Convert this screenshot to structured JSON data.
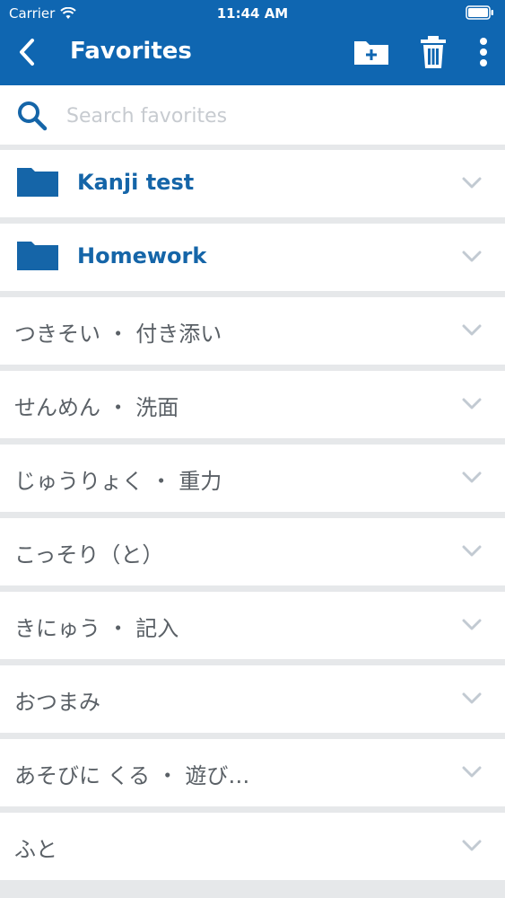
{
  "status_bar": {
    "carrier": "Carrier",
    "time": "11:44 AM"
  },
  "nav": {
    "title": "Favorites",
    "back_icon": "chevron-left-icon",
    "new_folder_icon": "folder-plus-icon",
    "delete_icon": "trash-icon",
    "more_icon": "more-vertical-icon"
  },
  "search": {
    "placeholder": "Search favorites",
    "value": ""
  },
  "folders": [
    {
      "label": "Kanji test"
    },
    {
      "label": "Homework"
    }
  ],
  "words": [
    {
      "label": "つきそい ・ 付き添い"
    },
    {
      "label": "せんめん ・ 洗面"
    },
    {
      "label": "じゅうりょく ・ 重力"
    },
    {
      "label": "こっそり（と）"
    },
    {
      "label": "きにゅう ・ 記入"
    },
    {
      "label": "おつまみ"
    },
    {
      "label": "あそびに くる ・ 遊び…"
    },
    {
      "label": "ふと"
    }
  ],
  "colors": {
    "brand": "#0f66b1",
    "folder": "#1565a8",
    "text": "#5a6066",
    "chevron": "#c2cad2",
    "background": "#e6e8ea"
  }
}
